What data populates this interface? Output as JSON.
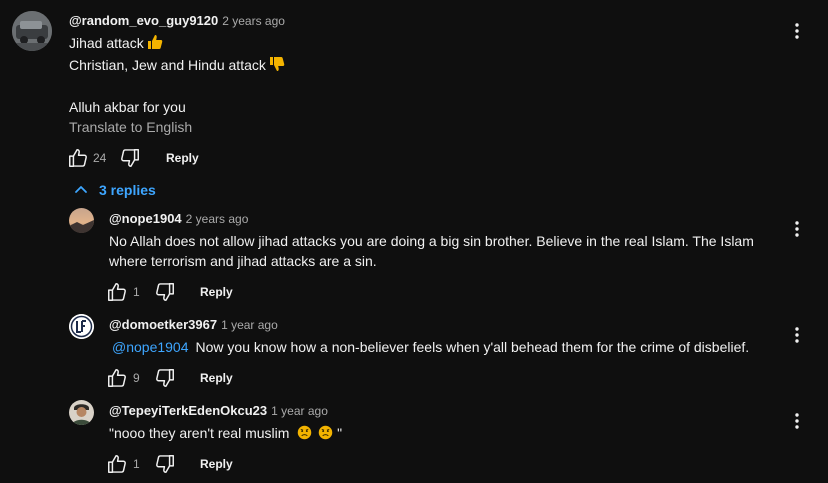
{
  "comments": {
    "main": {
      "author": "@random_evo_guy9120",
      "time": "2 years ago",
      "line1": "Jihad attack",
      "line2": "Christian, Jew and Hindu attack",
      "line3": "Alluh akbar for you",
      "translate": "Translate to English",
      "likes": "24",
      "reply_label": "Reply",
      "replies_toggle": "3 replies"
    },
    "replies": [
      {
        "author": "@nope1904",
        "time": "2 years ago",
        "line1": "No Allah does not allow jihad attacks you are doing a big sin brother. Believe in the real Islam. The Islam",
        "line2": "where terrorism and jihad attacks are a sin.",
        "likes": "1",
        "reply_label": "Reply"
      },
      {
        "author": "@domoetker3967",
        "time": "1 year ago",
        "mention": "@nope1904",
        "text": "Now you know how a non-believer feels when y'all behead them for the crime of disbelief.",
        "likes": "9",
        "reply_label": "Reply"
      },
      {
        "author": "@TepeyiTerkEdenOkcu23",
        "time": "1 year ago",
        "text_start": "\"nooo they aren't real muslim",
        "text_end": "\"",
        "likes": "1",
        "reply_label": "Reply"
      }
    ]
  },
  "icons": {
    "like": "thumbs-up-icon",
    "dislike": "thumbs-down-icon",
    "menu": "more-vertical-icon",
    "chevron": "chevron-up-icon",
    "thumbs_up_emoji": "thumbs-up-emoji",
    "thumbs_down_emoji": "thumbs-down-emoji",
    "sad_emoji": "sad-face-emoji"
  },
  "colors": {
    "background": "#0f0f0f",
    "text": "#f1f1f1",
    "secondary": "#aaaaaa",
    "link": "#3ea6ff",
    "emoji": "#f4b400"
  }
}
